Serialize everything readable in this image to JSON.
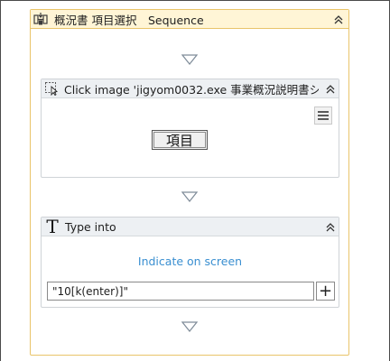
{
  "sequence": {
    "title": "概況書 項目選択　Sequence",
    "icon": "sequence-icon",
    "collapse_icon": "double-chevron-up-icon"
  },
  "click_image": {
    "title": "Click image 'jigyom0032.exe 事業概況説明書シ...",
    "icon": "click-image-icon",
    "collapse_icon": "double-chevron-up-icon",
    "menu_icon": "hamburger-menu-icon",
    "target_label": "項目"
  },
  "type_into": {
    "title": "Type into",
    "icon": "type-into-icon",
    "icon_glyph": "T",
    "collapse_icon": "double-chevron-up-icon",
    "indicate_label": "Indicate on screen",
    "input_value": "\"10[k(enter)]\"",
    "plus_label": "+"
  },
  "drop_zone_icon": "drop-arrow-icon",
  "colors": {
    "sequence_border": "#e9c46a",
    "sequence_header": "#fff5d6",
    "activity_header": "#edf0f3",
    "link": "#3a8fd1"
  }
}
